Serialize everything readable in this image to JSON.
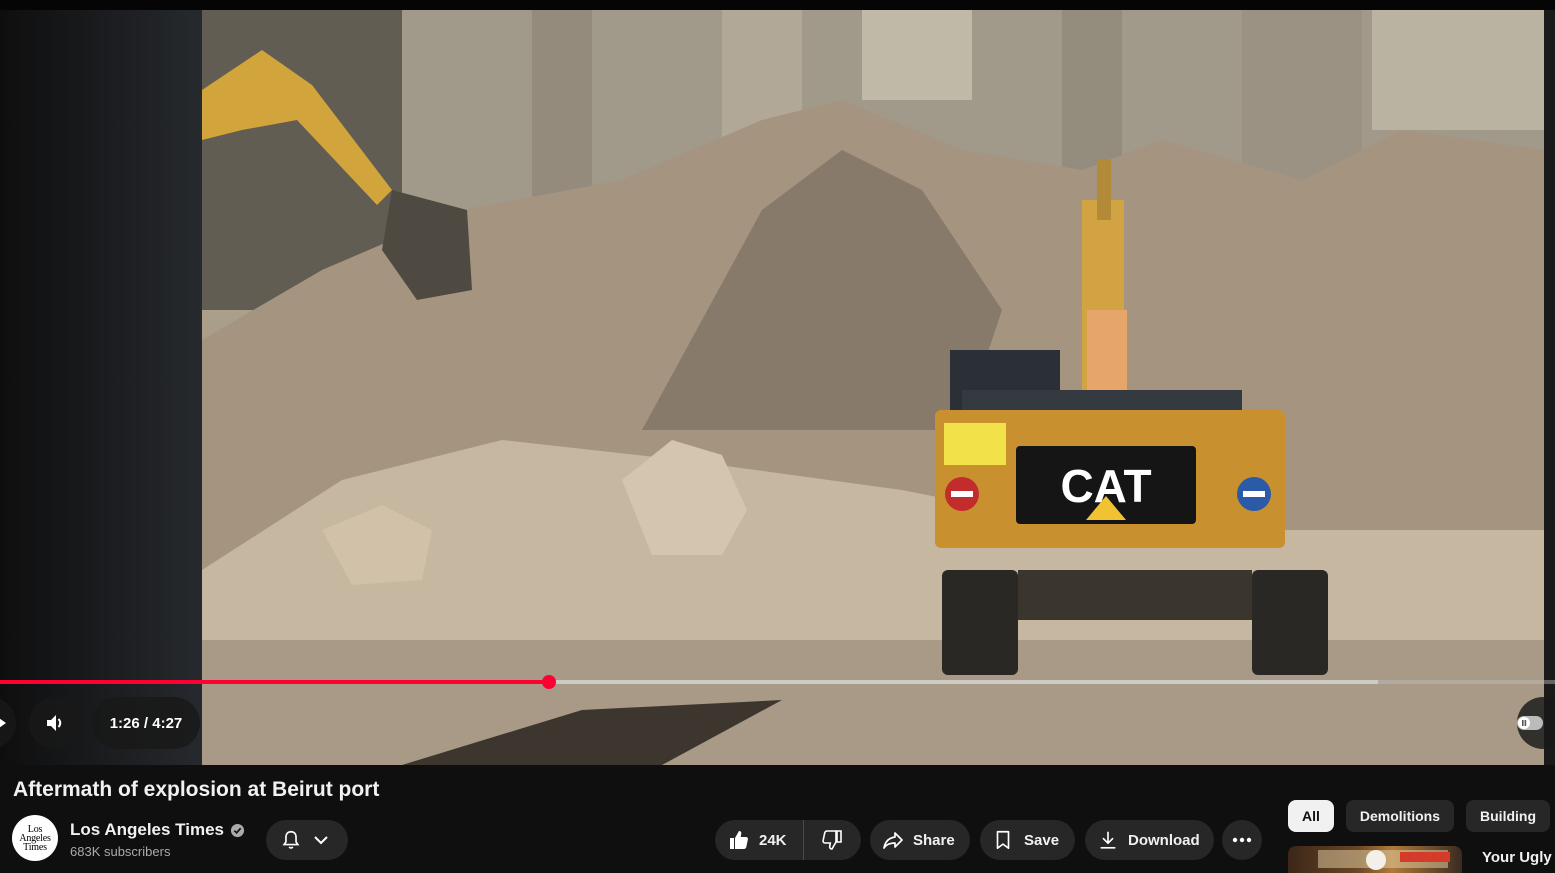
{
  "player": {
    "current_time": "1:26",
    "separator": "/",
    "duration": "4:27",
    "progress_fraction": 0.353,
    "buffered_fraction": 0.886
  },
  "video_scene": {
    "machine_brand": "CAT"
  },
  "video": {
    "title": "Aftermath of explosion at Beirut port"
  },
  "channel": {
    "name": "Los Angeles Times",
    "subscribers": "683K subscribers",
    "logo_text": [
      "Los",
      "Angeles",
      "Times"
    ]
  },
  "actions": {
    "like_count": "24K",
    "share_label": "Share",
    "save_label": "Save",
    "download_label": "Download"
  },
  "chips": [
    {
      "label": "All",
      "active": true
    },
    {
      "label": "Demolitions",
      "active": false
    },
    {
      "label": "Building",
      "active": false
    }
  ],
  "recommendation": {
    "title": "Your Ugly C"
  },
  "colors": {
    "background": "#0f0f0f",
    "accent": "#ff0033",
    "pill": "#272727",
    "text": "#f1f1f1",
    "secondary_text": "#aaaaaa"
  }
}
